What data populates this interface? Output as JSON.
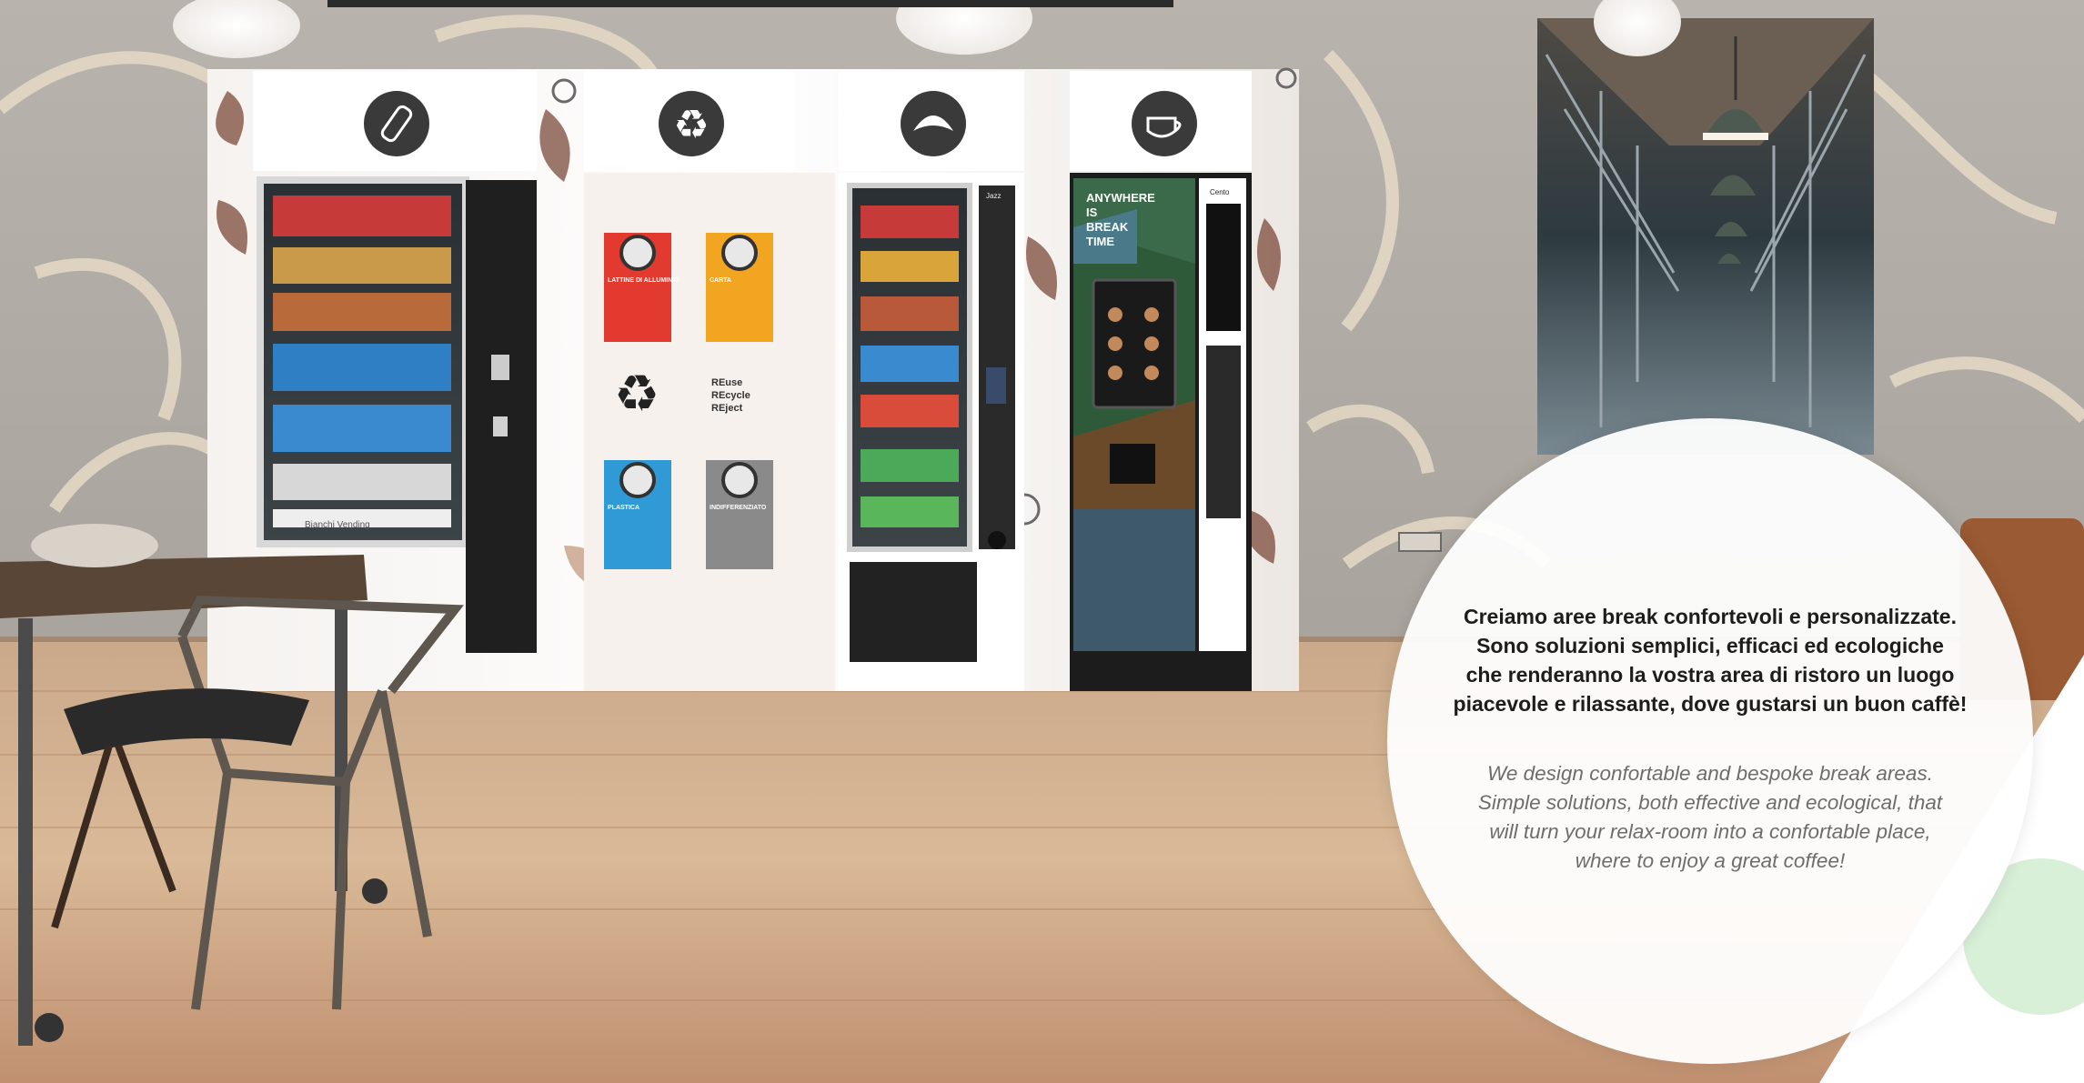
{
  "caption": {
    "italian_lines": [
      "Creiamo aree break confortevoli e personalizzate.",
      "Sono soluzioni semplici, efficaci ed ecologiche",
      "che renderanno la vostra area di ristoro un luogo",
      "piacevole e rilassante, dove gustarsi un buon caffè!"
    ],
    "english_lines": [
      "We design confortable and bespoke break areas.",
      "Simple solutions, both effective and ecological, that",
      "will turn your relax-room into a confortable place,",
      "where to enjoy a great coffee!"
    ]
  },
  "recycling": {
    "aluminium_label": "LATTINE DI ALLUMINIO",
    "paper_label": "CARTA",
    "plastic_label": "PLASTICA",
    "waste_label": "INDIFFERENZIATO",
    "motto_lines": [
      "REuse",
      "REcycle",
      "REject"
    ]
  },
  "machines": {
    "snack_brand": "Bianchi Vending",
    "panel_label": "Jazz",
    "coffee_panel_label": "Cento",
    "coffee_screen_lines": [
      "ANYWHERE",
      "IS",
      "BREAK",
      "TIME"
    ]
  },
  "icons": [
    "bottle-icon",
    "recycle-icon",
    "croissant-icon",
    "coffee-cup-icon"
  ],
  "colors": {
    "aluminium_bin": "#e23a2e",
    "paper_bin": "#f2a520",
    "plastic_bin": "#2f9ad6",
    "waste_bin": "#8a8a8a",
    "icon_circle": "#3a3a3a",
    "accent_green": "#d8efd8"
  }
}
